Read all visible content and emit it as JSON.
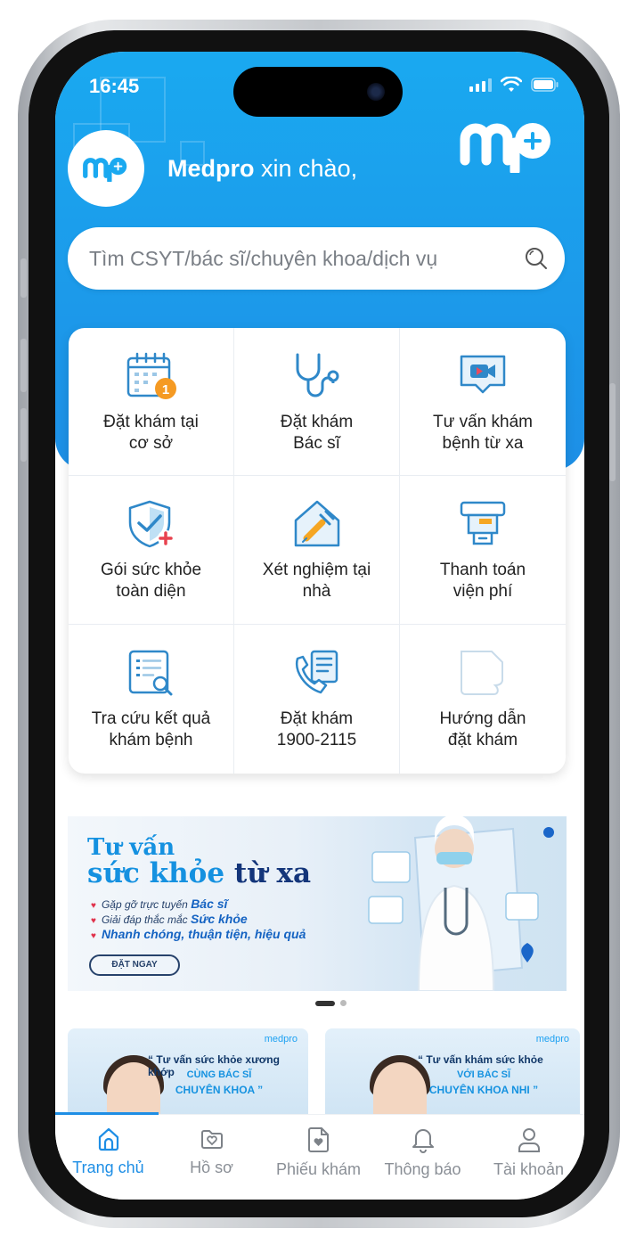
{
  "status_bar": {
    "time": "16:45"
  },
  "header": {
    "brand": "Medpro",
    "greeting": "xin chào,"
  },
  "search": {
    "placeholder": "Tìm CSYT/bác sĩ/chuyên khoa/dịch vụ"
  },
  "services": [
    {
      "label": "Đặt khám tại\ncơ sở",
      "icon": "calendar-icon"
    },
    {
      "label": "Đặt khám\nBác sĩ",
      "icon": "stethoscope-icon"
    },
    {
      "label": "Tư vấn khám\nbệnh từ xa",
      "icon": "video-call-icon"
    },
    {
      "label": "Gói sức khỏe\ntoàn diện",
      "icon": "shield-check-icon"
    },
    {
      "label": "Xét nghiệm tại\nnhà",
      "icon": "syringe-icon"
    },
    {
      "label": "Thanh toán\nviện phí",
      "icon": "payment-icon"
    },
    {
      "label": "Tra cứu kết quả\nkhám bệnh",
      "icon": "search-result-icon"
    },
    {
      "label": "Đặt khám\n1900-2115",
      "icon": "phone-icon"
    },
    {
      "label": "Hướng dẫn\nđặt khám",
      "icon": "guide-icon"
    }
  ],
  "banner": {
    "title_line1": "Tư vấn",
    "title_line2_a": "sức khỏe",
    "title_line2_b": "từ xa",
    "bullets": [
      {
        "text": "Gặp gỡ trực tuyến",
        "em": "Bác sĩ"
      },
      {
        "text": "Giải đáp thắc mắc",
        "em": "Sức khỏe"
      },
      {
        "text": "",
        "em": "Nhanh chóng, thuận tiện, hiệu quả"
      }
    ],
    "cta": "ĐẶT NGAY"
  },
  "cards": [
    {
      "brand": "medpro",
      "line1": "“ Tư vấn sức khỏe xương khớp",
      "line2": "CÙNG BÁC SĨ",
      "line3": "CHUYÊN KHOA ”"
    },
    {
      "brand": "medpro",
      "line1": "“ Tư vấn khám sức khỏe",
      "line2": "VỚI BÁC SĨ",
      "line3": "CHUYÊN KHOA NHI ”"
    }
  ],
  "tabs": [
    {
      "label": "Trang chủ",
      "active": true
    },
    {
      "label": "Hồ sơ",
      "active": false
    },
    {
      "label": "Phiếu khám",
      "active": false
    },
    {
      "label": "Thông báo",
      "active": false
    },
    {
      "label": "Tài khoản",
      "active": false
    }
  ],
  "colors": {
    "primary": "#1e8ee5",
    "hero": "#1aa9f0",
    "accent_orange": "#f59a23"
  }
}
